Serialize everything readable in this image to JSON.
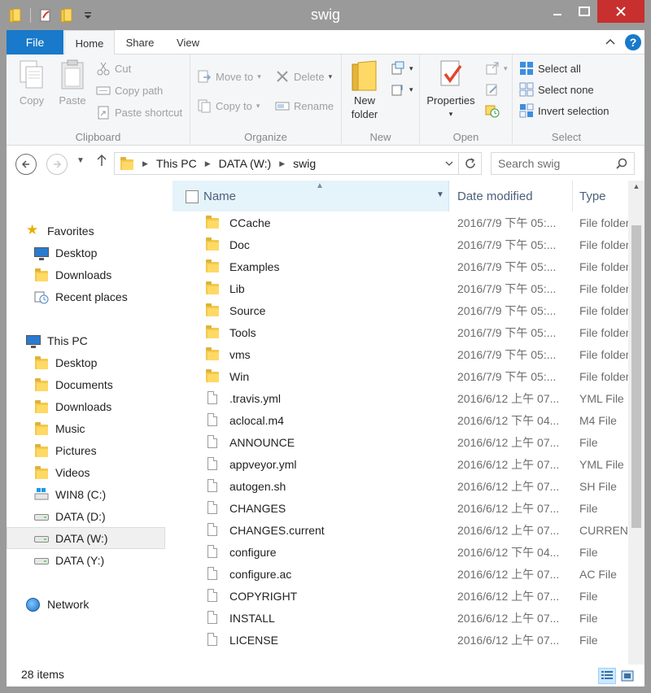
{
  "window": {
    "title": "swig",
    "accent_color": "#1979ca",
    "close_color": "#c7302f"
  },
  "ribbon": {
    "tabs": {
      "file": "File",
      "home": "Home",
      "share": "Share",
      "view": "View"
    },
    "clipboard": {
      "label": "Clipboard",
      "copy": "Copy",
      "paste": "Paste",
      "cut": "Cut",
      "copy_path": "Copy path",
      "paste_shortcut": "Paste shortcut"
    },
    "organize": {
      "label": "Organize",
      "move_to": "Move to",
      "copy_to": "Copy to",
      "delete": "Delete",
      "rename": "Rename"
    },
    "new": {
      "label": "New",
      "new_folder": "New folder"
    },
    "open": {
      "label": "Open",
      "properties": "Properties"
    },
    "select": {
      "label": "Select",
      "select_all": "Select all",
      "select_none": "Select none",
      "invert_selection": "Invert selection"
    }
  },
  "address": {
    "crumbs": [
      "This PC",
      "DATA (W:)",
      "swig"
    ],
    "search_placeholder": "Search swig"
  },
  "nav": {
    "favorites": "Favorites",
    "favorites_items": [
      "Desktop",
      "Downloads",
      "Recent places"
    ],
    "this_pc": "This PC",
    "this_pc_items": [
      "Desktop",
      "Documents",
      "Downloads",
      "Music",
      "Pictures",
      "Videos",
      "WIN8 (C:)",
      "DATA (D:)",
      "DATA (W:)",
      "DATA (Y:)"
    ],
    "selected": "DATA (W:)",
    "network": "Network"
  },
  "list": {
    "columns": {
      "name": "Name",
      "date": "Date modified",
      "type": "Type"
    },
    "rows": [
      {
        "name": "CCache",
        "date": "2016/7/9 下午 05:...",
        "type": "File folder",
        "kind": "folder"
      },
      {
        "name": "Doc",
        "date": "2016/7/9 下午 05:...",
        "type": "File folder",
        "kind": "folder"
      },
      {
        "name": "Examples",
        "date": "2016/7/9 下午 05:...",
        "type": "File folder",
        "kind": "folder"
      },
      {
        "name": "Lib",
        "date": "2016/7/9 下午 05:...",
        "type": "File folder",
        "kind": "folder"
      },
      {
        "name": "Source",
        "date": "2016/7/9 下午 05:...",
        "type": "File folder",
        "kind": "folder"
      },
      {
        "name": "Tools",
        "date": "2016/7/9 下午 05:...",
        "type": "File folder",
        "kind": "folder"
      },
      {
        "name": "vms",
        "date": "2016/7/9 下午 05:...",
        "type": "File folder",
        "kind": "folder"
      },
      {
        "name": "Win",
        "date": "2016/7/9 下午 05:...",
        "type": "File folder",
        "kind": "folder"
      },
      {
        "name": ".travis.yml",
        "date": "2016/6/12 上午 07...",
        "type": "YML File",
        "kind": "file"
      },
      {
        "name": "aclocal.m4",
        "date": "2016/6/12 下午 04...",
        "type": "M4 File",
        "kind": "file"
      },
      {
        "name": "ANNOUNCE",
        "date": "2016/6/12 上午 07...",
        "type": "File",
        "kind": "file"
      },
      {
        "name": "appveyor.yml",
        "date": "2016/6/12 上午 07...",
        "type": "YML File",
        "kind": "file"
      },
      {
        "name": "autogen.sh",
        "date": "2016/6/12 上午 07...",
        "type": "SH File",
        "kind": "file"
      },
      {
        "name": "CHANGES",
        "date": "2016/6/12 上午 07...",
        "type": "File",
        "kind": "file"
      },
      {
        "name": "CHANGES.current",
        "date": "2016/6/12 上午 07...",
        "type": "CURRENT",
        "kind": "file"
      },
      {
        "name": "configure",
        "date": "2016/6/12 下午 04...",
        "type": "File",
        "kind": "file"
      },
      {
        "name": "configure.ac",
        "date": "2016/6/12 上午 07...",
        "type": "AC File",
        "kind": "file"
      },
      {
        "name": "COPYRIGHT",
        "date": "2016/6/12 上午 07...",
        "type": "File",
        "kind": "file"
      },
      {
        "name": "INSTALL",
        "date": "2016/6/12 上午 07...",
        "type": "File",
        "kind": "file"
      },
      {
        "name": "LICENSE",
        "date": "2016/6/12 上午 07...",
        "type": "File",
        "kind": "file"
      }
    ]
  },
  "status": {
    "count": "28 items"
  }
}
